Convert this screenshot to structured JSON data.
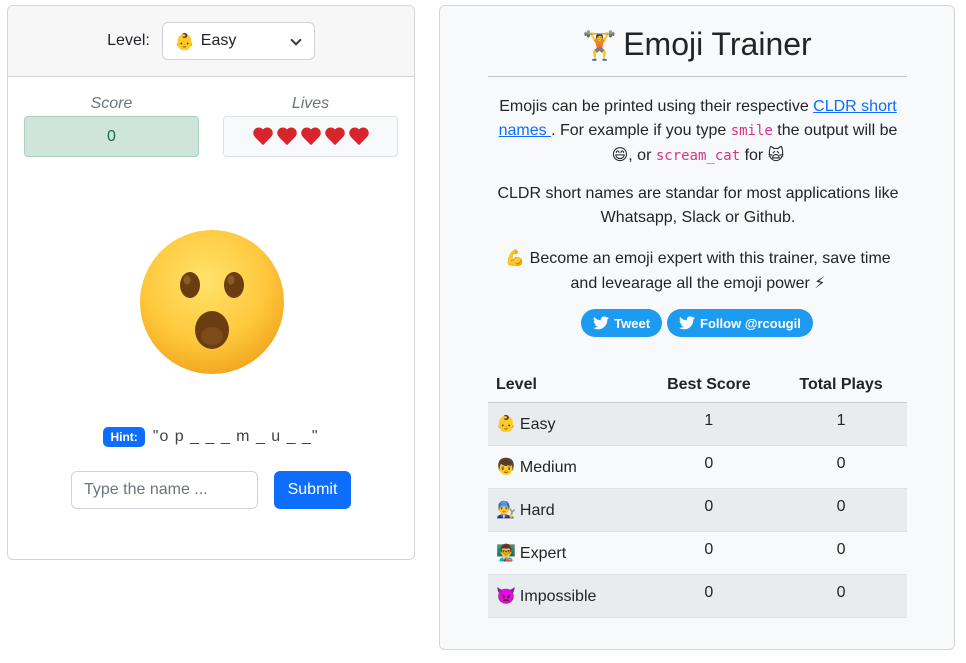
{
  "level_selector": {
    "label": "Level:",
    "selected_emoji": "👶",
    "selected": "Easy"
  },
  "stats": {
    "score_label": "Score",
    "score_value": "0",
    "lives_label": "Lives",
    "lives_count": 5,
    "heart_color": "#d6262b"
  },
  "current_emoji": {
    "icon": "face-with-open-mouth-icon",
    "colors": {
      "face": "#ffc83d",
      "features": "#6b3e12"
    }
  },
  "hint": {
    "badge": "Hint:",
    "text": "\"o p _ _ _ m _ u _ _\""
  },
  "answer": {
    "placeholder": "Type the name ...",
    "submit_label": "Submit"
  },
  "info": {
    "title_emoji": "🏋",
    "title": "Emoji Trainer",
    "p1_before_link": "Emojis can be printed using their respective ",
    "p1_link": "CLDR short names ",
    "p1_mid": ". For example if you type ",
    "p1_code1": "smile",
    "p1_after_code1": " the output will be ",
    "p1_emoji1": "😄",
    "p1_or": ", or ",
    "p1_code2": "scream_cat",
    "p1_for": " for ",
    "p1_emoji2": "🙀",
    "p2": "CLDR short names are standar for most applications like Whatsapp, Slack or Github.",
    "p3_emoji": "💪",
    "p3_text": " Become an emoji expert with this trainer, save time and levearage all the emoji power ",
    "p3_emoji_end": "⚡"
  },
  "social": {
    "tweet_label": "Tweet",
    "follow_label": "Follow @rcougil",
    "brand_color": "#1d9bf0"
  },
  "levels_table": {
    "headers": [
      "Level",
      "Best Score",
      "Total Plays"
    ],
    "rows": [
      {
        "emoji": "👶",
        "level": "Easy",
        "best": "1",
        "plays": "1"
      },
      {
        "emoji": "👦",
        "level": "Medium",
        "best": "0",
        "plays": "0"
      },
      {
        "emoji": "👨‍🔧",
        "level": "Hard",
        "best": "0",
        "plays": "0"
      },
      {
        "emoji": "👨‍🏫",
        "level": "Expert",
        "best": "0",
        "plays": "0"
      },
      {
        "emoji": "👿",
        "level": "Impossible",
        "best": "0",
        "plays": "0"
      }
    ]
  }
}
